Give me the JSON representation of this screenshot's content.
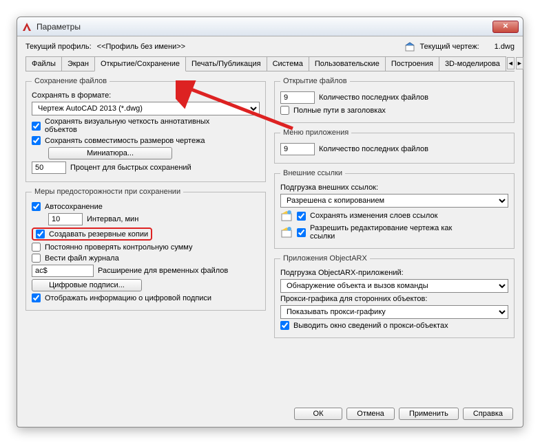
{
  "window": {
    "title": "Параметры"
  },
  "profile": {
    "label": "Текущий профиль:",
    "value": "<<Профиль без имени>>",
    "drawing_label": "Текущий чертеж:",
    "drawing_value": "1.dwg"
  },
  "tabs": {
    "items": [
      "Файлы",
      "Экран",
      "Открытие/Сохранение",
      "Печать/Публикация",
      "Система",
      "Пользовательские",
      "Построения",
      "3D-моделирова"
    ],
    "active_index": 2
  },
  "left": {
    "save_files": {
      "legend": "Сохранение файлов",
      "format_label": "Сохранять в формате:",
      "format_value": "Чертеж AutoCAD 2013 (*.dwg)",
      "visual_fidelity": "Сохранять визуальную четкость аннотативных объектов",
      "dim_compat": "Сохранять совместимость размеров чертежа",
      "miniature_btn": "Миниатюра...",
      "percent_value": "50",
      "percent_label": "Процент для быстрых сохранений"
    },
    "precaution": {
      "legend": "Меры предосторожности при сохранении",
      "autosave": "Автосохранение",
      "interval_value": "10",
      "interval_label": "Интервал, мин",
      "backup": "Создавать резервные копии",
      "checksum": "Постоянно проверять контрольную сумму",
      "log": "Вести файл журнала",
      "ext_value": "ac$",
      "ext_label": "Расширение для временных файлов",
      "sign_btn": "Цифровые подписи...",
      "show_sign": "Отображать информацию о цифровой подписи"
    }
  },
  "right": {
    "open_files": {
      "legend": "Открытие файлов",
      "recent_value": "9",
      "recent_label": "Количество последних файлов",
      "full_paths": "Полные пути в заголовках"
    },
    "app_menu": {
      "legend": "Меню приложения",
      "recent_value": "9",
      "recent_label": "Количество последних файлов"
    },
    "xrefs": {
      "legend": "Внешние ссылки",
      "load_label": "Подгрузка внешних ссылок:",
      "load_value": "Разрешена с копированием",
      "save_layer": "Сохранять изменения слоев ссылок",
      "allow_edit": "Разрешить редактирование чертежа как ссылки"
    },
    "arx": {
      "legend": "Приложения ObjectARX",
      "load_label": "Подгрузка ObjectARX-приложений:",
      "load_value": "Обнаружение объекта и вызов команды",
      "proxy_label": "Прокси-графика для сторонних объектов:",
      "proxy_value": "Показывать прокси-графику",
      "proxy_dlg": "Выводить окно сведений о прокси-объектах"
    }
  },
  "footer": {
    "ok": "ОК",
    "cancel": "Отмена",
    "apply": "Применить",
    "help": "Справка"
  }
}
